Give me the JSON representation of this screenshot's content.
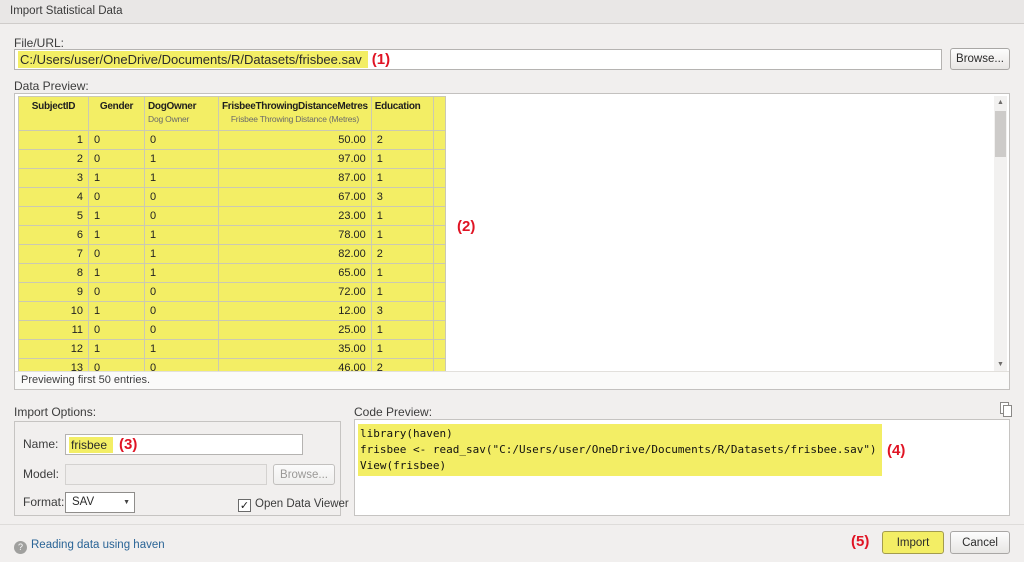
{
  "dialog": {
    "title": "Import Statistical Data"
  },
  "annotations": {
    "a1": "(1)",
    "a2": "(2)",
    "a3": "(3)",
    "a4": "(4)",
    "a5": "(5)"
  },
  "icons": {
    "scroll_up": "▲",
    "scroll_down": "▼",
    "select_arrow": "▼",
    "check": "✓",
    "help": "?"
  },
  "file_url": {
    "label": "File/URL:",
    "value": "C:/Users/user/OneDrive/Documents/R/Datasets/frisbee.sav",
    "browse_label": "Browse..."
  },
  "data_preview": {
    "label": "Data Preview:",
    "footer": "Previewing first 50 entries.",
    "columns": [
      {
        "title": "SubjectID",
        "subtitle": ""
      },
      {
        "title": "Gender",
        "subtitle": ""
      },
      {
        "title": "DogOwner",
        "subtitle": "Dog Owner"
      },
      {
        "title": "FrisbeeThrowingDistanceMetres",
        "subtitle": "Frisbee Throwing Distance (Metres)"
      },
      {
        "title": "Education",
        "subtitle": ""
      }
    ],
    "rows": [
      [
        "1",
        "0",
        "0",
        "50.00",
        "2"
      ],
      [
        "2",
        "0",
        "1",
        "97.00",
        "1"
      ],
      [
        "3",
        "1",
        "1",
        "87.00",
        "1"
      ],
      [
        "4",
        "0",
        "0",
        "67.00",
        "3"
      ],
      [
        "5",
        "1",
        "0",
        "23.00",
        "1"
      ],
      [
        "6",
        "1",
        "1",
        "78.00",
        "1"
      ],
      [
        "7",
        "0",
        "1",
        "82.00",
        "2"
      ],
      [
        "8",
        "1",
        "1",
        "65.00",
        "1"
      ],
      [
        "9",
        "0",
        "0",
        "72.00",
        "1"
      ],
      [
        "10",
        "1",
        "0",
        "12.00",
        "3"
      ],
      [
        "11",
        "0",
        "0",
        "25.00",
        "1"
      ],
      [
        "12",
        "1",
        "1",
        "35.00",
        "1"
      ],
      [
        "13",
        "0",
        "0",
        "46.00",
        "2"
      ]
    ]
  },
  "import_options": {
    "label": "Import Options:",
    "name_label": "Name:",
    "name_value": "frisbee",
    "model_label": "Model:",
    "model_value": "",
    "model_browse_label": "Browse...",
    "format_label": "Format:",
    "format_value": "SAV",
    "open_data_viewer_label": "Open Data Viewer"
  },
  "code_preview": {
    "label": "Code Preview:",
    "line1": "library(haven)",
    "line2": "frisbee <- read_sav(\"C:/Users/user/OneDrive/Documents/R/Datasets/frisbee.sav\")",
    "line3": "View(frisbee)"
  },
  "footer": {
    "help_label": "Reading data using haven",
    "import_label": "Import",
    "cancel_label": "Cancel"
  }
}
